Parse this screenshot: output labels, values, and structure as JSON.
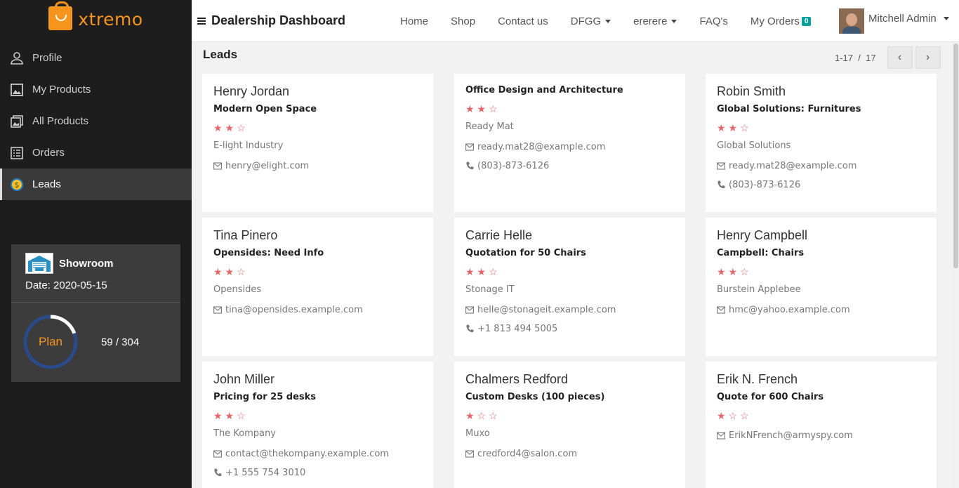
{
  "app": {
    "logo_text": "xtremo",
    "dashboard_title": "Dealership Dashboard"
  },
  "sidebar": {
    "items": [
      {
        "label": "Profile",
        "icon": "user-icon"
      },
      {
        "label": "My Products",
        "icon": "image-icon"
      },
      {
        "label": "All Products",
        "icon": "gallery-icon"
      },
      {
        "label": "Orders",
        "icon": "list-icon"
      },
      {
        "label": "Leads",
        "icon": "dollar-icon",
        "active": true
      }
    ],
    "showroom": {
      "title": "Showroom",
      "date": "Date: 2020-05-15",
      "plan_label": "Plan",
      "plan_count": "59 / 304",
      "plan_used": 59,
      "plan_total": 304
    }
  },
  "topnav": {
    "links": [
      {
        "label": "Home"
      },
      {
        "label": "Shop"
      },
      {
        "label": "Contact us"
      },
      {
        "label": "DFGG",
        "dropdown": true
      },
      {
        "label": "ererere",
        "dropdown": true
      },
      {
        "label": "FAQ's"
      },
      {
        "label": "My Orders",
        "badge": "0"
      }
    ],
    "user_name": "Mitchell Admin"
  },
  "main": {
    "section_title": "Leads",
    "pager": {
      "range": "1-17",
      "separator": "/",
      "total": "17"
    }
  },
  "cards": [
    {
      "name": "Henry Jordan",
      "title": "Modern Open Space",
      "stars": 2,
      "company": "E-light Industry",
      "email": "henry@elight.com",
      "phone": ""
    },
    {
      "name": "",
      "title": "Office Design and Architecture",
      "stars": 2,
      "company": "Ready Mat",
      "email": "ready.mat28@example.com",
      "phone": "(803)-873-6126"
    },
    {
      "name": "Robin Smith",
      "title": "Global Solutions: Furnitures",
      "stars": 2,
      "company": "Global Solutions",
      "email": "ready.mat28@example.com",
      "phone": "(803)-873-6126"
    },
    {
      "name": "Tina Pinero",
      "title": "Opensides: Need Info",
      "stars": 2,
      "company": "Opensides",
      "email": "tina@opensides.example.com",
      "phone": ""
    },
    {
      "name": "Carrie Helle",
      "title": "Quotation for 50 Chairs",
      "stars": 2,
      "company": "Stonage IT",
      "email": "helle@stonageit.example.com",
      "phone": "+1 813 494 5005"
    },
    {
      "name": "Henry Campbell",
      "title": "Campbell: Chairs",
      "stars": 2,
      "company": "Burstein Applebee",
      "email": "hmc@yahoo.example.com",
      "phone": ""
    },
    {
      "name": "John Miller",
      "title": "Pricing for 25 desks",
      "stars": 2,
      "company": "The Kompany",
      "email": "contact@thekompany.example.com",
      "phone": "+1 555 754 3010"
    },
    {
      "name": "Chalmers Redford",
      "title": "Custom Desks (100 pieces)",
      "stars": 1,
      "company": "Muxo",
      "email": "credford4@salon.com",
      "phone": ""
    },
    {
      "name": "Erik N. French",
      "title": "Quote for 600 Chairs",
      "stars": 1,
      "company": "",
      "email": "ErikNFrench@armyspy.com",
      "phone": ""
    }
  ],
  "colors": {
    "accent": "#f7941d",
    "sidebar_bg": "#1d1d1d",
    "star": "#e8676b",
    "badge": "#00a09d"
  }
}
